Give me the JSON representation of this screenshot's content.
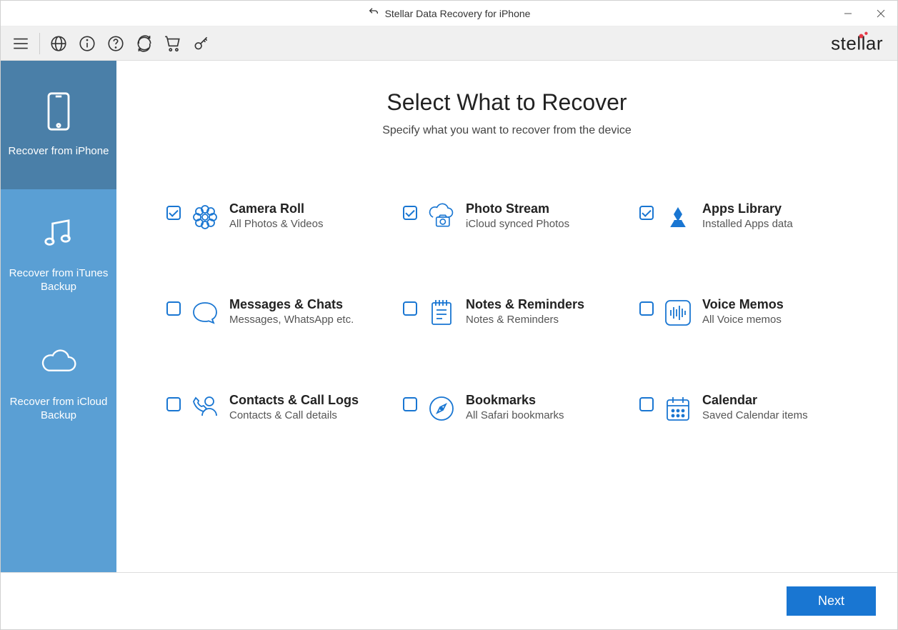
{
  "titlebar": {
    "title": "Stellar Data Recovery for iPhone"
  },
  "logo": {
    "text": "stellar"
  },
  "sidebar": {
    "items": [
      {
        "label": "Recover from iPhone",
        "active": true
      },
      {
        "label": "Recover from iTunes Backup",
        "active": false
      },
      {
        "label": "Recover from iCloud Backup",
        "active": false
      }
    ]
  },
  "main": {
    "title": "Select What to Recover",
    "subtitle": "Specify what you want to recover from the device"
  },
  "options": [
    {
      "title": "Camera Roll",
      "desc": "All Photos & Videos",
      "checked": true,
      "icon": "flower"
    },
    {
      "title": "Photo Stream",
      "desc": "iCloud synced Photos",
      "checked": true,
      "icon": "cloud-camera"
    },
    {
      "title": "Apps Library",
      "desc": "Installed Apps data",
      "checked": true,
      "icon": "apps"
    },
    {
      "title": "Messages & Chats",
      "desc": "Messages, WhatsApp etc.",
      "checked": false,
      "icon": "chat"
    },
    {
      "title": "Notes & Reminders",
      "desc": "Notes & Reminders",
      "checked": false,
      "icon": "notes"
    },
    {
      "title": "Voice Memos",
      "desc": "All Voice memos",
      "checked": false,
      "icon": "voice"
    },
    {
      "title": "Contacts & Call Logs",
      "desc": "Contacts & Call details",
      "checked": false,
      "icon": "contacts"
    },
    {
      "title": "Bookmarks",
      "desc": "All Safari bookmarks",
      "checked": false,
      "icon": "compass"
    },
    {
      "title": "Calendar",
      "desc": "Saved Calendar items",
      "checked": false,
      "icon": "calendar"
    }
  ],
  "footer": {
    "next": "Next"
  }
}
